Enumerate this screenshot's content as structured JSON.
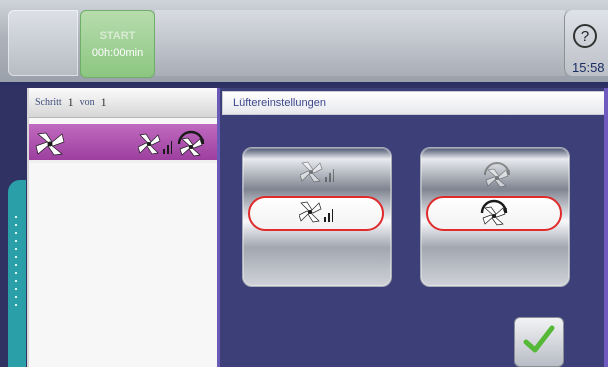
{
  "topbar": {
    "start_label": "START",
    "start_time": "00h:00min",
    "help_symbol": "?",
    "clock": "15:58"
  },
  "left_panel": {
    "step_label": "Schritt",
    "step_current": "1",
    "step_of": "von",
    "step_total": "1"
  },
  "right_panel": {
    "title": "Lüftereinstellungen"
  },
  "icons": {
    "fan": "fan-icon",
    "fan_speed": "fan-speed-icon",
    "fan_reverse": "fan-reverse-icon",
    "help": "help-icon",
    "check": "check-icon"
  },
  "colors": {
    "start_green": "#8cc682",
    "step_purple": "#a845aa",
    "selection_red": "#df2b2b",
    "accent_blue": "#2d2f61",
    "teal_tab": "#2b9fa8"
  }
}
